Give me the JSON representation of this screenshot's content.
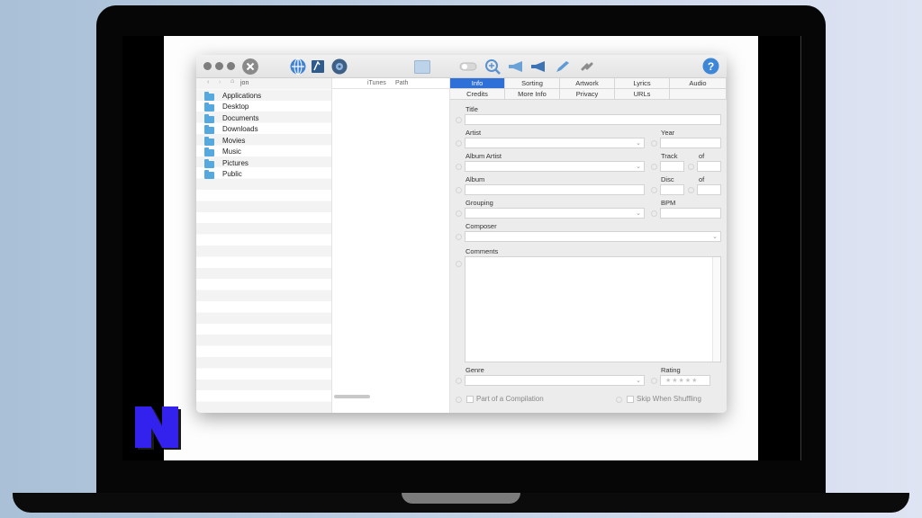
{
  "sidebar": {
    "path": "jon",
    "items": [
      "Applications",
      "Desktop",
      "Documents",
      "Downloads",
      "Movies",
      "Music",
      "Pictures",
      "Public"
    ]
  },
  "file_list": {
    "columns": [
      "iTunes",
      "Path"
    ]
  },
  "tabs": {
    "row1": [
      "Info",
      "Sorting",
      "Artwork",
      "Lyrics",
      "Audio"
    ],
    "row2": [
      "Credits",
      "More Info",
      "Privacy",
      "URLs"
    ],
    "active": "Info"
  },
  "fields": {
    "title": "Title",
    "artist": "Artist",
    "year": "Year",
    "album_artist": "Album Artist",
    "track": "Track",
    "of1": "of",
    "album": "Album",
    "disc": "Disc",
    "of2": "of",
    "grouping": "Grouping",
    "bpm": "BPM",
    "composer": "Composer",
    "comments": "Comments",
    "genre": "Genre",
    "rating": "Rating",
    "rating_stars": "★★★★★"
  },
  "checkboxes": {
    "compilation": "Part of a Compilation",
    "skip": "Skip When Shuffling"
  },
  "icons": [
    "close-icon",
    "web-icon",
    "book-icon",
    "disc-icon",
    "image-icon",
    "toggle-icon",
    "zoom-icon",
    "megaphone-icon",
    "megaphone-icon",
    "pencil-icon",
    "link-icon",
    "help-icon",
    "folder-icon",
    "home-icon"
  ],
  "colors": {
    "accent": "#2f6fd8",
    "folder": "#56a9df",
    "brand": "#3322ee"
  }
}
